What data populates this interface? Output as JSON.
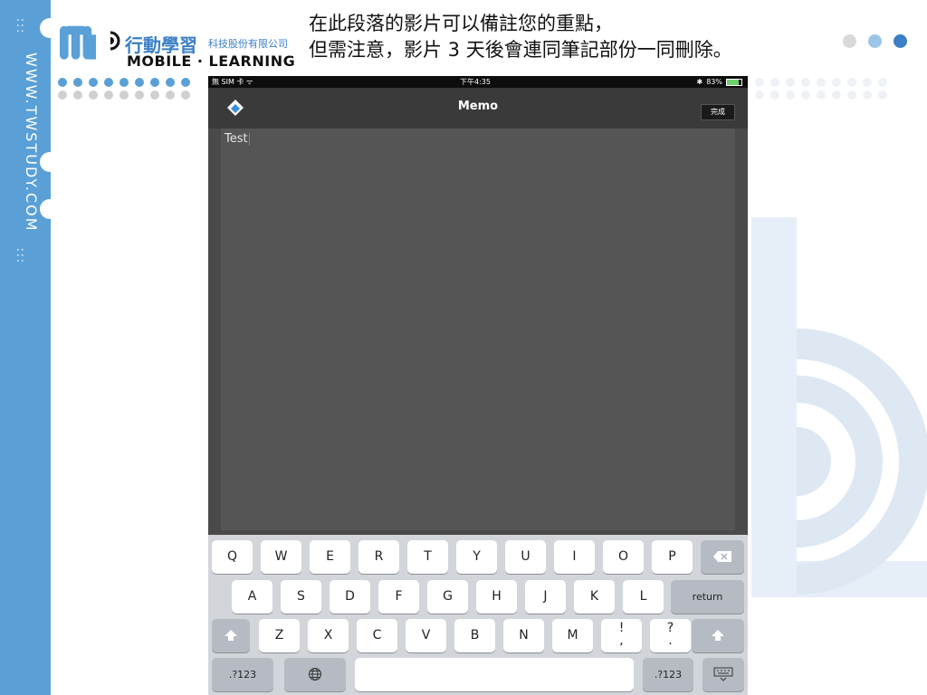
{
  "sidebar": {
    "url_text": "WWW.TWSTUDY.COM",
    "dots_top": ":::",
    "dots_bottom": ":::"
  },
  "logo": {
    "cn_name": "行動學習",
    "cn_company": "科技股份有限公司",
    "en_name": "MOBILE · LEARNING"
  },
  "notes": {
    "line1": "在此段落的影片可以備註您的重點，",
    "line2": "但需注意，影片 3 天後會連同筆記部份一同刪除。"
  },
  "device": {
    "status": {
      "carrier": "無 SIM 卡 ᯤ",
      "time": "下午4:35",
      "bluetooth": "✱",
      "battery_pct": "83%",
      "battery_level": 0.83
    },
    "nav": {
      "title": "Memo",
      "done_label": "完成",
      "app_icon": "pencil-eraser-icon"
    },
    "memo": {
      "text": "Test"
    },
    "keyboard": {
      "row1": [
        "Q",
        "W",
        "E",
        "R",
        "T",
        "Y",
        "U",
        "I",
        "O",
        "P"
      ],
      "row2": [
        "A",
        "S",
        "D",
        "F",
        "G",
        "H",
        "J",
        "K",
        "L"
      ],
      "row3": [
        "Z",
        "X",
        "C",
        "V",
        "B",
        "N",
        "M",
        "!\n,",
        "?\n."
      ],
      "return_label": "return",
      "numbers_label": ".?123",
      "backspace_icon": "backspace-icon",
      "shift_icon": "shift-icon",
      "globe_icon": "globe-icon",
      "hide_keyboard_icon": "keyboard-hide-icon"
    }
  },
  "colors": {
    "side_band": "#5aa0d6",
    "accent": "#3b7fc6",
    "dot_blue": "#5aa0d6",
    "dot_grey": "#d0d0d0"
  }
}
